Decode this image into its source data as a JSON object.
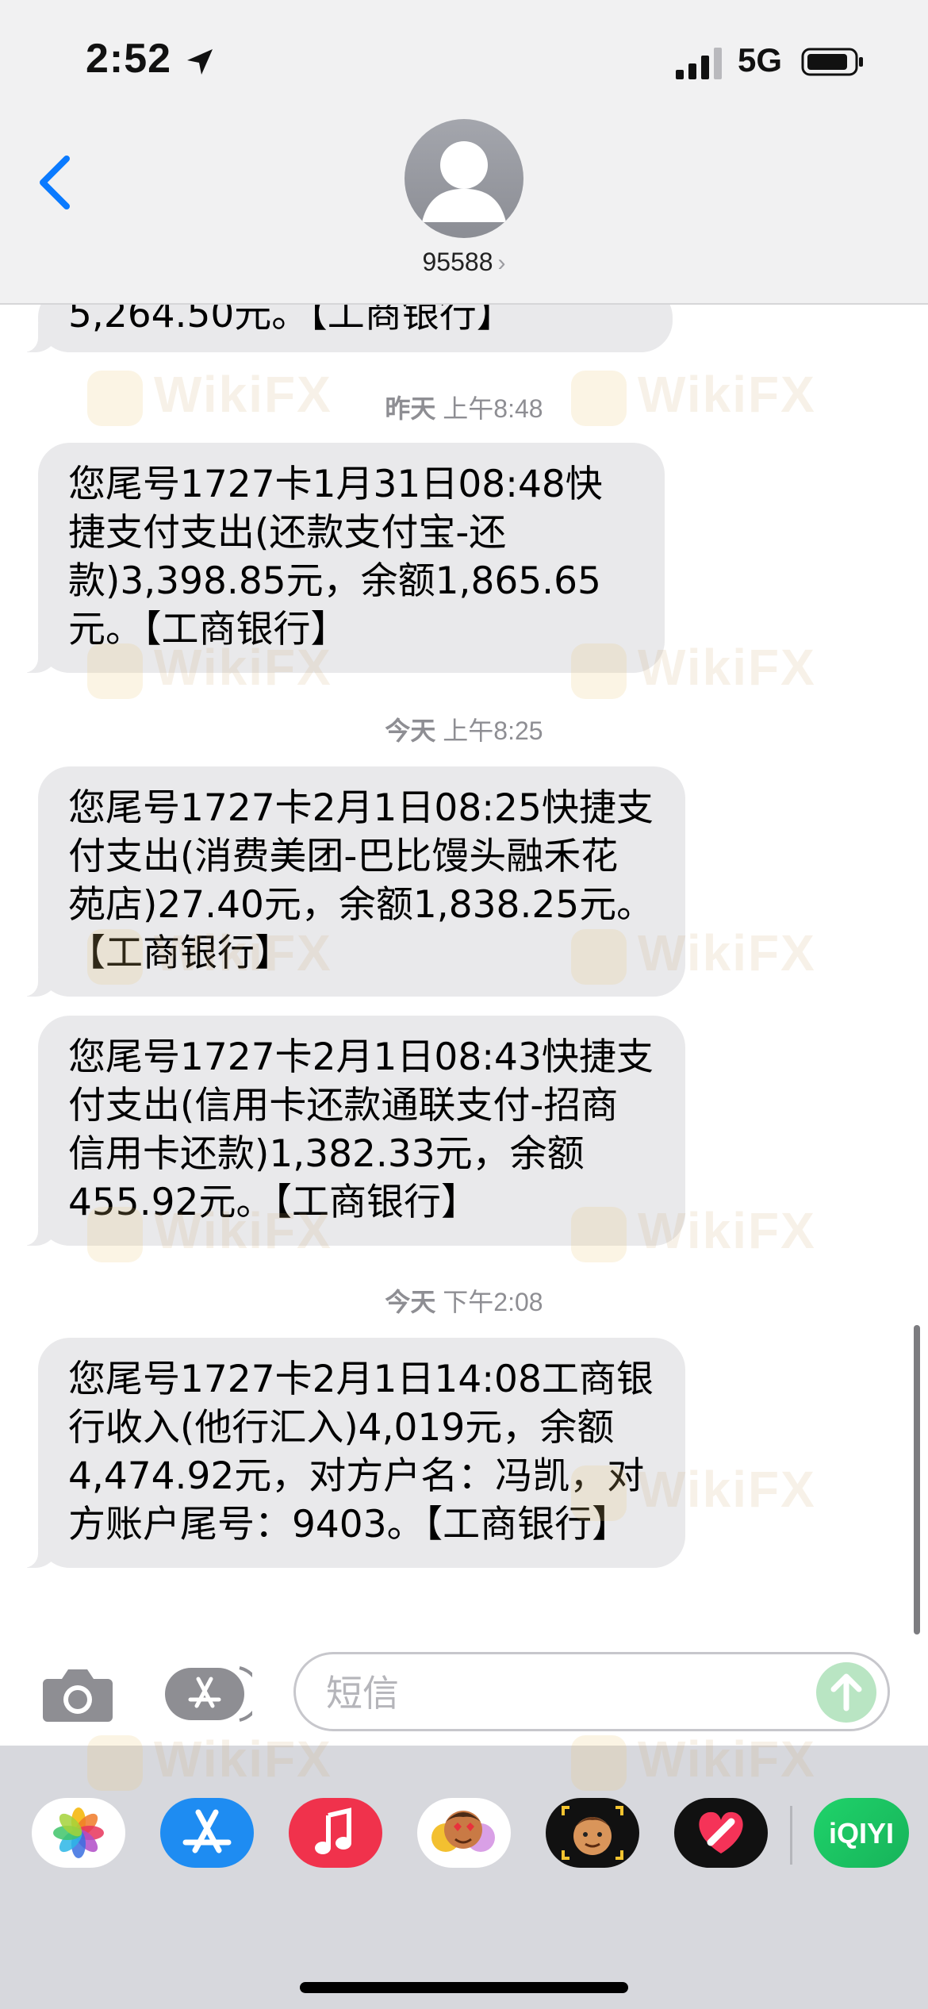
{
  "status_bar": {
    "time": "2:52",
    "network": "5G",
    "signal_bars": 3
  },
  "header": {
    "contact": "95588",
    "chevron": "›"
  },
  "messages": [
    {
      "type": "bubble",
      "text": "5,264.50元。【工商银行】"
    },
    {
      "type": "timestamp",
      "day": "昨天",
      "time": "上午8:48"
    },
    {
      "type": "bubble",
      "text": "您尾号1727卡1月31日08:48快捷支付支出(还款支付宝-还款)3,398.85元，余额1,865.65元。【工商银行】"
    },
    {
      "type": "timestamp",
      "day": "今天",
      "time": "上午8:25"
    },
    {
      "type": "bubble",
      "text": "您尾号1727卡2月1日08:25快捷支付支出(消费美团-巴比馒头融禾花苑店)27.40元，余额1,838.25元。【工商银行】"
    },
    {
      "type": "bubble",
      "text": "您尾号1727卡2月1日08:43快捷支付支出(信用卡还款通联支付-招商信用卡还款)1,382.33元，余额455.92元。【工商银行】"
    },
    {
      "type": "timestamp",
      "day": "今天",
      "time": "下午2:08"
    },
    {
      "type": "bubble",
      "text": "您尾号1727卡2月1日14:08工商银行收入(他行汇入)4,019元，余额4,474.92元，对方户名：冯凯，对方账户尾号：9403。【工商银行】"
    }
  ],
  "input": {
    "placeholder": "短信"
  },
  "drawer_apps": [
    {
      "name": "photos-icon"
    },
    {
      "name": "app-store-icon"
    },
    {
      "name": "music-icon"
    },
    {
      "name": "memoji-stickers-icon"
    },
    {
      "name": "memoji-icon"
    },
    {
      "name": "digital-touch-icon"
    },
    {
      "name": "iqiyi-icon",
      "label": "iQIYI"
    }
  ],
  "watermark": "WikiFX",
  "colors": {
    "bubble": "#e9e9eb",
    "accent": "#0a7aff",
    "send": "#b9e5c3"
  }
}
